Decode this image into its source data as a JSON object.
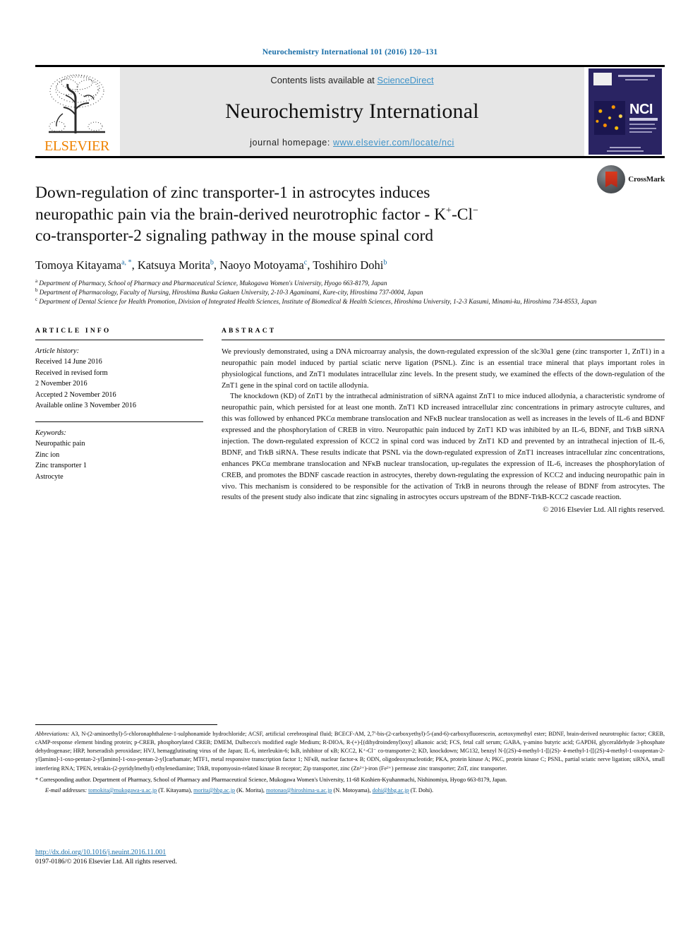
{
  "running_head": "Neurochemistry International 101 (2016) 120–131",
  "masthead": {
    "contents_prefix": "Contents lists available at ",
    "sciencedirect": "ScienceDirect",
    "journal_name": "Neurochemistry International",
    "homepage_prefix": "journal homepage: ",
    "homepage_url": "www.elsevier.com/locate/nci",
    "publisher": "ELSEVIER",
    "cover_title": "NCI",
    "accent_blue": "#3f93c8",
    "elsevier_orange": "#ef8200",
    "cover_navy": "#2a2463"
  },
  "article": {
    "title_line1": "Down-regulation of zinc transporter-1 in astrocytes induces",
    "title_line2_a": "neuropathic pain via the brain-derived neurotrophic factor - K",
    "title_line2_sup1": "+",
    "title_line2_b": "-Cl",
    "title_line2_sup2": "−",
    "title_line3": "co-transporter-2 signaling pathway in the mouse spinal cord",
    "crossmark_label": "CrossMark",
    "authors_plain": "Tomoya Kitayama a, *, Katsuya Morita b, Naoyo Motoyama c, Toshihiro Dohi b",
    "authors": [
      {
        "name": "Tomoya Kitayama",
        "marks": "a, *"
      },
      {
        "name": "Katsuya Morita",
        "marks": "b"
      },
      {
        "name": "Naoyo Motoyama",
        "marks": "c"
      },
      {
        "name": "Toshihiro Dohi",
        "marks": "b"
      }
    ],
    "affiliations": [
      {
        "mark": "a",
        "text": "Department of Pharmacy, School of Pharmacy and Pharmaceutical Science, Mukogawa Women's University, Hyogo 663-8179, Japan"
      },
      {
        "mark": "b",
        "text": "Department of Pharmacology, Faculty of Nursing, Hiroshima Bunka Gakuen University, 2-10-3 Agaminami, Kure-city, Hiroshima 737-0004, Japan"
      },
      {
        "mark": "c",
        "text": "Department of Dental Science for Health Promotion, Division of Integrated Health Sciences, Institute of Biomedical & Health Sciences, Hiroshima University, 1-2-3 Kasumi, Minami-ku, Hiroshima 734-8553, Japan"
      }
    ]
  },
  "article_info": {
    "heading": "ARTICLE INFO",
    "history_label": "Article history:",
    "history": [
      "Received 14 June 2016",
      "Received in revised form",
      "2 November 2016",
      "Accepted 2 November 2016",
      "Available online 3 November 2016"
    ],
    "keywords_label": "Keywords:",
    "keywords": [
      "Neuropathic pain",
      "Zinc ion",
      "Zinc transporter 1",
      "Astrocyte"
    ]
  },
  "abstract": {
    "heading": "ABSTRACT",
    "paragraph1": "We previously demonstrated, using a DNA microarray analysis, the down-regulated expression of the slc30a1 gene (zinc transporter 1, ZnT1) in a neuropathic pain model induced by partial sciatic nerve ligation (PSNL). Zinc is an essential trace mineral that plays important roles in physiological functions, and ZnT1 modulates intracellular zinc levels. In the present study, we examined the effects of the down-regulation of the ZnT1 gene in the spinal cord on tactile allodynia.",
    "paragraph2": "The knockdown (KD) of ZnT1 by the intrathecal administration of siRNA against ZnT1 to mice induced allodynia, a characteristic syndrome of neuropathic pain, which persisted for at least one month. ZnT1 KD increased intracellular zinc concentrations in primary astrocyte cultures, and this was followed by enhanced PKCα membrane translocation and NFκB nuclear translocation as well as increases in the levels of IL-6 and BDNF expressed and the phosphorylation of CREB in vitro. Neuropathic pain induced by ZnT1 KD was inhibited by an IL-6, BDNF, and TrkB siRNA injection. The down-regulated expression of KCC2 in spinal cord was induced by ZnT1 KD and prevented by an intrathecal injection of IL-6, BDNF, and TrkB siRNA. These results indicate that PSNL via the down-regulated expression of ZnT1 increases intracellular zinc concentrations, enhances PKCα membrane translocation and NFκB nuclear translocation, up-regulates the expression of IL-6, increases the phosphorylation of CREB, and promotes the BDNF cascade reaction in astrocytes, thereby down-regulating the expression of KCC2 and inducing neuropathic pain in vivo. This mechanism is considered to be responsible for the activation of TrkB in neurons through the release of BDNF from astrocytes. The results of the present study also indicate that zinc signaling in astrocytes occurs upstream of the BDNF-TrkB-KCC2 cascade reaction.",
    "copyright": "© 2016 Elsevier Ltd. All rights reserved."
  },
  "footnotes": {
    "abbreviations_label": "Abbreviations:",
    "abbreviations_text": " A3, N-(2-aminoethyl)-5-chloronaphthalene-1-sulphonamide hydrochloride; ACSF, artificial cerebrospinal fluid; BCECF-AM, 2,7'-bis-(2-carboxyethyl)-5-(and-6)-carboxyfluorescein, acetoxymethyl ester; BDNF, brain-derived neurotrophic factor; CREB, cAMP-response element binding protein; p-CREB, phosphorylated CREB; DMEM, Dulbecco's modified eagle Medium; R-DIOA, R-(+)-[(dihydroindenyl)oxy] alkanoic acid; FCS, fetal calf serum; GABA, γ-amino butyric acid; GAPDH, glyceraldehyde 3-phosphate dehydrogenase; HRP, horseradish peroxidase; HVJ, hemagglutinating virus of the Japan; IL-6, interleukin-6; IκB, inhibitor of κB; KCC2, K⁺-Cl⁻ co-transporter-2; KD, knockdown; MG132, benzyl N-[(2S)-4-methyl-1-[[(2S)- 4-methyl-1-[[(2S)-4-methyl-1-oxopentan-2-yl]amino]-1-oxo-pentan-2-yl]amino]-1-oxo-pentan-2-yl]carbamate; MTF1, metal responsive transcription factor 1; NFκB, nuclear factor-κ B; ODN, oligodeoxynucleotide; PKA, protein kinase A; PKC, protein kinase C; PSNL, partial sciatic nerve ligation; siRNA, small interfering RNA; TPEN, tetrakis-(2-pyridylmethyl) ethylenediamine; TrkB, tropomyosin-related kinase B receptor; Zip transporter, zinc (Zn²⁺)-iron (Fe²⁺) permease zinc transporter; ZnT, zinc transporter.",
    "corresponding": "* Corresponding author. Department of Pharmacy, School of Pharmacy and Pharmaceutical Science, Mukogawa Women's University, 11-68 Koshien-Kyuhanmachi, Nishinomiya, Hyogo 663-8179, Japan.",
    "email_label": "E-mail addresses:",
    "emails": [
      {
        "address": "tomokita@mukogawa-u.ac.jp",
        "owner": "(T. Kitayama)"
      },
      {
        "address": "morita@hbg.ac.jp",
        "owner": "(K. Morita)"
      },
      {
        "address": "motonao@hiroshima-u.ac.jp",
        "owner": "(N. Motoyama)"
      },
      {
        "address": "dohi@hbg.ac.jp",
        "owner": "(T. Dohi)"
      }
    ]
  },
  "doi_block": {
    "doi_url": "http://dx.doi.org/10.1016/j.neuint.2016.11.001",
    "issn_line": "0197-0186/© 2016 Elsevier Ltd. All rights reserved."
  }
}
